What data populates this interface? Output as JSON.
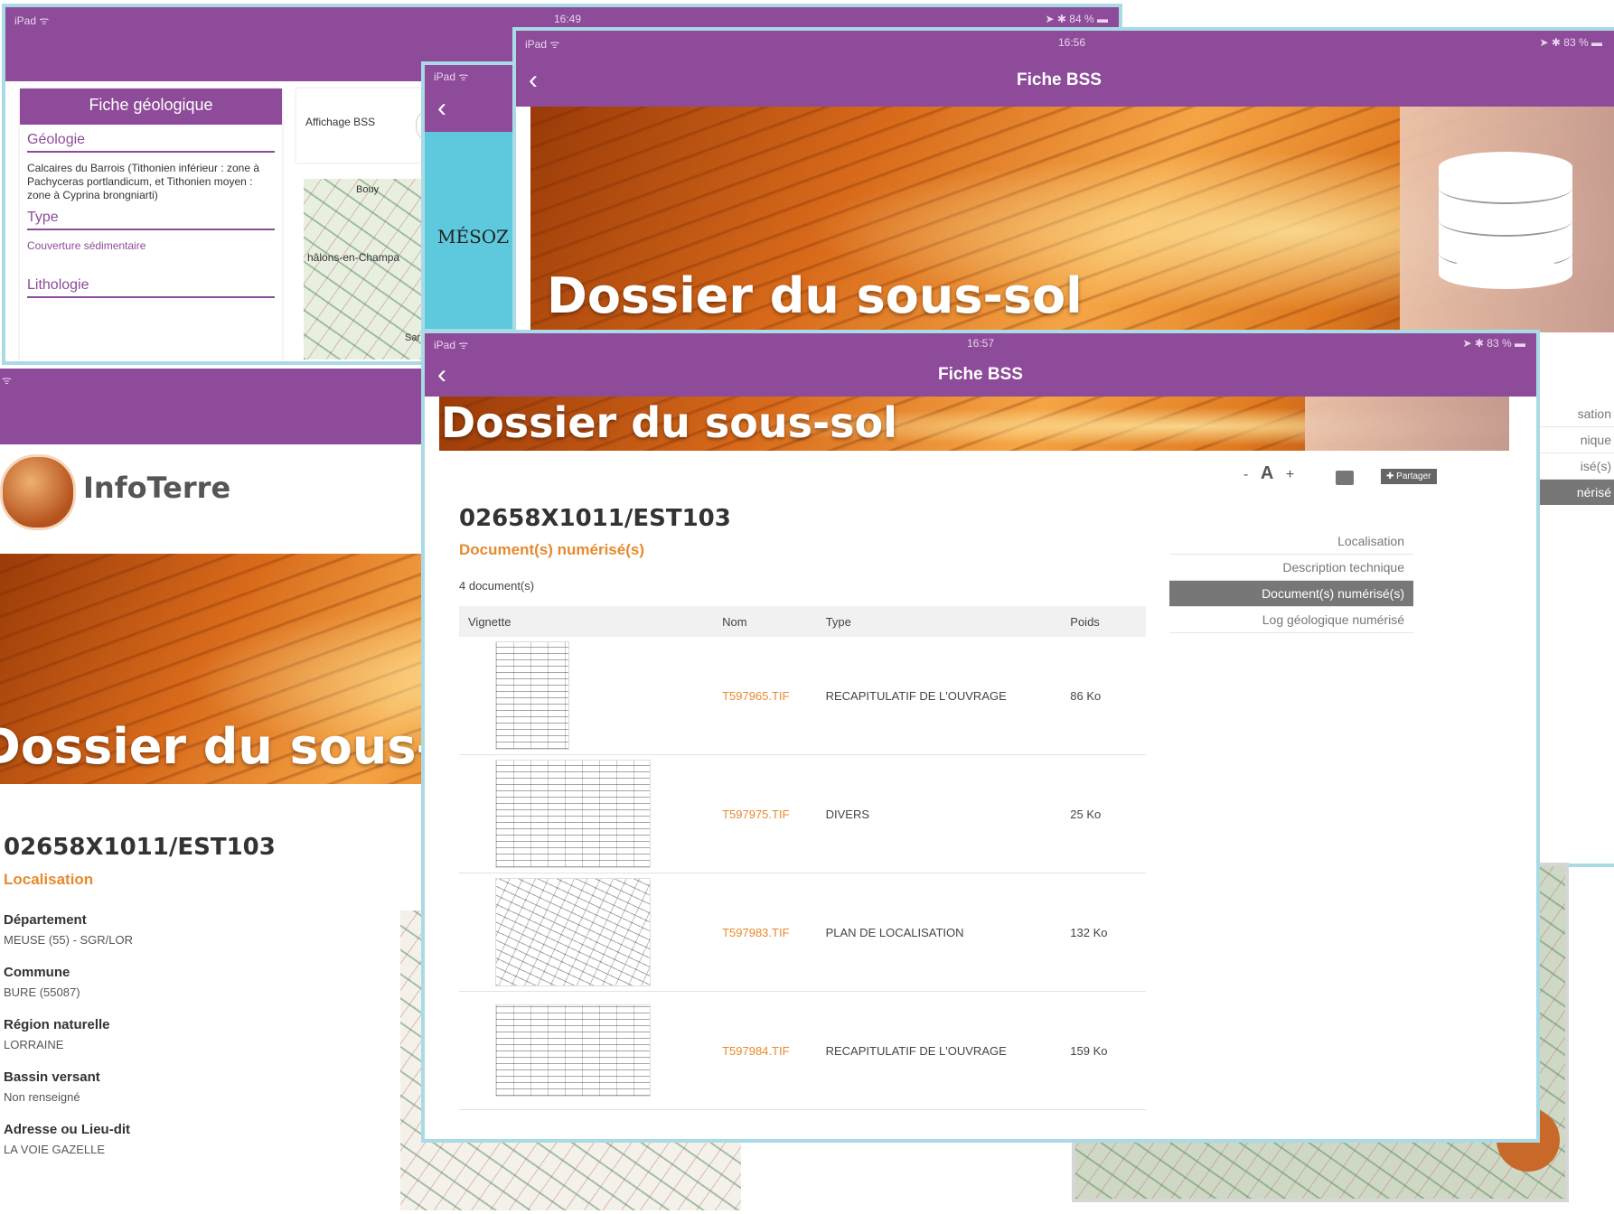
{
  "shot_a": {
    "status": {
      "left": "iPad ᯤ",
      "time": "16:49",
      "right": "➤ ✱ 84 % ▬"
    },
    "fiche_title": "Fiche géologique",
    "geologie": {
      "title": "Géologie",
      "text": "Calcaires du Barrois (Tithonien inférieur : zone à Pachyceras portlandicum, et Tithonien moyen : zone à Cyprina brongniarti)"
    },
    "type": {
      "title": "Type",
      "text": "Couverture sédimentaire"
    },
    "lithologie": {
      "title": "Lithologie"
    },
    "affichage_label": "Affichage BSS",
    "map_labels": [
      "Bouy",
      "hâlons-en-Champa",
      "Sar"
    ]
  },
  "shot_b": {
    "status": {
      "left": "iPad ᯤ"
    },
    "side_text": "MÉSOZ"
  },
  "shot_c": {
    "status": {
      "left": "iPad ᯤ",
      "time": "16:56",
      "right": "➤ ✱ 83 % ▬"
    },
    "nav_title": "Fiche BSS",
    "banner_title": "Dossier du sous-sol",
    "menu_partial": [
      "sation",
      "nique",
      "isé(s)",
      "nérisé"
    ]
  },
  "shot_d": {
    "status": {
      "left": "ᯤ"
    },
    "logo_text": "InfoTerre",
    "banner_title": "Dossier du sous-sol",
    "id": "02658X1011/EST103",
    "section": "Localisation",
    "fields": [
      {
        "label": "Département",
        "value": "MEUSE (55) - SGR/LOR"
      },
      {
        "label": "Commune",
        "value": "BURE (55087)"
      },
      {
        "label": "Région naturelle",
        "value": "LORRAINE"
      },
      {
        "label": "Bassin versant",
        "value": "Non renseigné"
      },
      {
        "label": "Adresse ou Lieu-dit",
        "value": "LA VOIE GAZELLE"
      }
    ]
  },
  "shot_e": {
    "status": {
      "left": "iPad ᯤ",
      "time": "16:57",
      "right": "➤ ✱ 83 % ▬"
    },
    "nav_title": "Fiche BSS",
    "banner_title": "Dossier du sous-sol",
    "toolbar": {
      "font_minus": "-",
      "font_a": "A",
      "font_plus": "+",
      "share_label": "✚ Partager"
    },
    "id": "02658X1011/EST103",
    "section": "Document(s) numérisé(s)",
    "count": "4 document(s)",
    "columns": [
      "Vignette",
      "Nom",
      "Type",
      "Poids"
    ],
    "rows": [
      {
        "nom": "T597965.TIF",
        "type": "RECAPITULATIF DE L'OUVRAGE",
        "poids": "86 Ko"
      },
      {
        "nom": "T597975.TIF",
        "type": "DIVERS",
        "poids": "25 Ko"
      },
      {
        "nom": "T597983.TIF",
        "type": "PLAN DE LOCALISATION",
        "poids": "132 Ko"
      },
      {
        "nom": "T597984.TIF",
        "type": "RECAPITULATIF DE L'OUVRAGE",
        "poids": "159 Ko"
      }
    ],
    "menu": [
      "Localisation",
      "Description technique",
      "Document(s) numérisé(s)",
      "Log géologique numérisé"
    ]
  },
  "colors": {
    "purple": "#8d4b99",
    "orange": "#e68a2e",
    "frame": "#a9dbe6"
  }
}
